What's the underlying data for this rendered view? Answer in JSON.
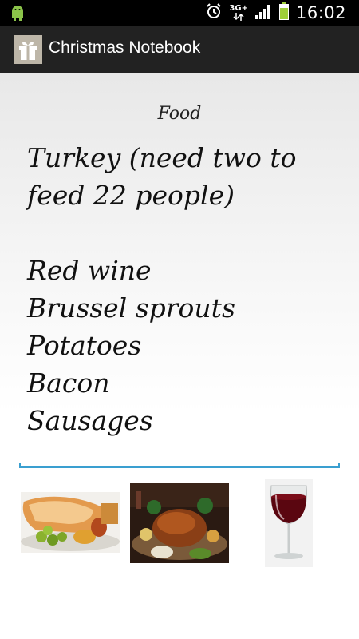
{
  "status_bar": {
    "time": "16:02",
    "network_type": "3G+",
    "icons": [
      "android-debug-icon",
      "alarm-icon",
      "network-type-icon",
      "signal-icon",
      "battery-icon"
    ]
  },
  "action_bar": {
    "title": "Christmas Notebook",
    "icon": "gift-icon"
  },
  "note": {
    "category": "Food",
    "body": "Turkey (need two to\nfeed 22 people)\n\nRed wine\nBrussel sprouts\nPotatoes\nBacon\nSausages"
  },
  "attachments": [
    {
      "name": "roast-dinner-image"
    },
    {
      "name": "roast-turkey-image"
    },
    {
      "name": "red-wine-image"
    }
  ],
  "colors": {
    "status_bar": "#000000",
    "action_bar": "#222222",
    "accent": "#3a9fd0"
  }
}
